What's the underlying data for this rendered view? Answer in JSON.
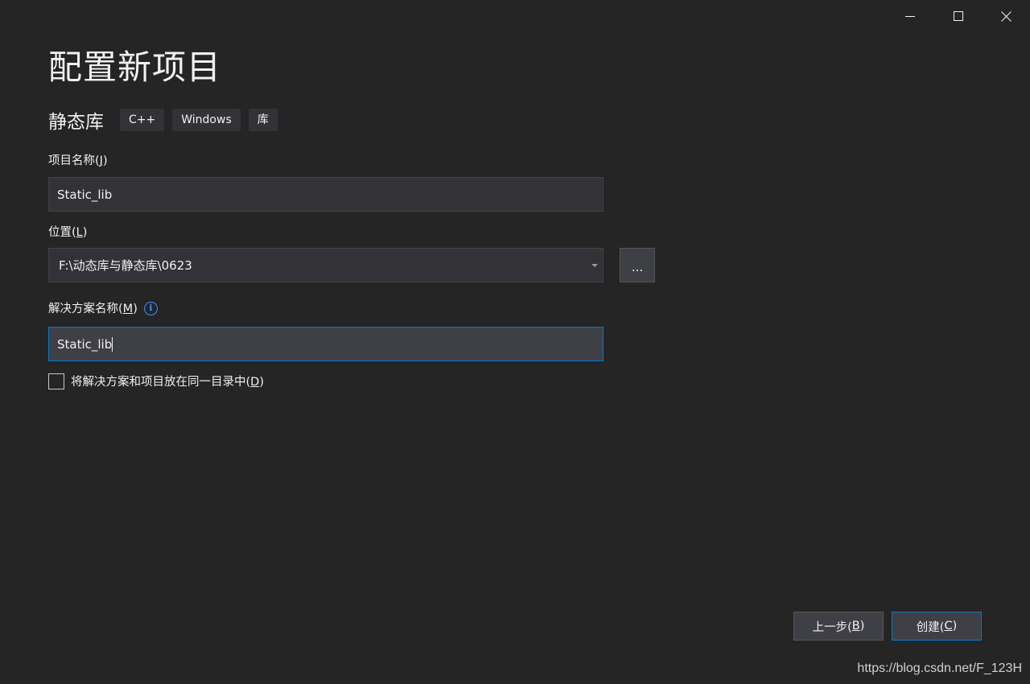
{
  "window": {
    "minimize_icon": "minimize-icon",
    "maximize_icon": "maximize-icon",
    "close_icon": "close-icon"
  },
  "page": {
    "title": "配置新项目"
  },
  "template": {
    "name": "静态库",
    "tags": [
      "C++",
      "Windows",
      "库"
    ]
  },
  "project_name": {
    "label_text": "项目名称(",
    "label_mnemonic": "J",
    "label_end": ")",
    "value": "Static_lib"
  },
  "location": {
    "label_text": "位置(",
    "label_mnemonic": "L",
    "label_end": ")",
    "value": "F:\\动态库与静态库\\0623",
    "browse_label": "..."
  },
  "solution_name": {
    "label_text": "解决方案名称(",
    "label_mnemonic": "M",
    "label_end": ")",
    "info_icon": "info-icon",
    "value": "Static_lib"
  },
  "same_dir": {
    "label_text": "将解决方案和项目放在同一目录中(",
    "label_mnemonic": "D",
    "label_end": ")",
    "checked": false
  },
  "footer": {
    "back_text": "上一步(",
    "back_mnemonic": "B",
    "back_end": ")",
    "create_text": "创建(",
    "create_mnemonic": "C",
    "create_end": ")"
  },
  "watermark": "https://blog.csdn.net/F_123H",
  "colors": {
    "background": "#252526",
    "input_bg": "#333337",
    "focus_border": "#007acc",
    "info_blue": "#3794ff"
  }
}
